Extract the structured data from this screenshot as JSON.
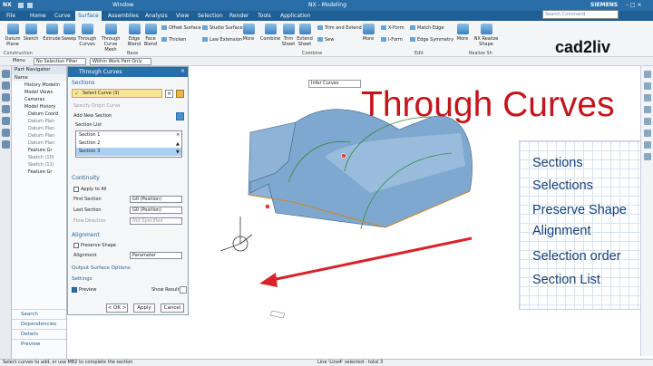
{
  "titlebar": {
    "logo": "NX",
    "window_menu": "Window",
    "title": "NX - Modeling",
    "brand": "SIEMENS"
  },
  "menu": [
    "File",
    "Home",
    "Curve",
    "Surface",
    "Assemblies",
    "Analysis",
    "View",
    "Selection",
    "Render",
    "Tools",
    "Application"
  ],
  "menu_active": "Surface",
  "search": {
    "placeholder": "Search Command"
  },
  "ribbon": {
    "buttons": [
      "Datum Plane",
      "Sketch",
      "Extrude",
      "Sweep",
      "Through Curves",
      "Through Curve Mesh",
      "Edge Blend",
      "Face Blend",
      "More",
      "Combine",
      "Trim Sheet",
      "Extend Sheet",
      "More",
      "X-Form",
      "I-Form",
      "More",
      "NX Realize Shape"
    ],
    "small": [
      "Offset Surface",
      "Studio Surface",
      "Thicken",
      "Law Extension",
      "Trim and Extend",
      "Sew",
      "Match Edge",
      "Edge Symmetry"
    ],
    "groups": [
      "Construction",
      "Base",
      "Combine",
      "Edit",
      "Realize Sh"
    ]
  },
  "toolbar": {
    "menu": "Menu",
    "filter": "No Selection Filter",
    "scope": "Within Work Part Only"
  },
  "brand_text": "cad2liv",
  "partnav": {
    "title": "Part Navigator",
    "col": "Name",
    "items": [
      "History Modelin",
      "Model Views",
      "Cameras",
      "Model History",
      "Datum Coord",
      "Datum Plan",
      "Datum Plan",
      "Datum Plan",
      "Datum Plan",
      "Feature Gr",
      "Sketch (10)",
      "Sketch (11)",
      "Feature Gr"
    ],
    "panels": [
      "Search",
      "Dependencies",
      "Details",
      "Preview"
    ]
  },
  "dialog": {
    "title": "Through Curves",
    "sections": "Sections",
    "select_curve": "Select Curve (3)",
    "specify_origin": "Specify Origin Curve",
    "add_new": "Add New Section",
    "section_list": "Section List",
    "list": [
      "Section 1",
      "Section 2",
      "Section 3"
    ],
    "continuity": "Continuity",
    "apply_to_all": "Apply to All",
    "first_section": "First Section",
    "first_val": "G0 (Position)",
    "last_section": "Last Section",
    "last_val": "G0 (Position)",
    "flow": "Flow Direction",
    "flow_val": "Not Specified",
    "alignment": "Alignment",
    "preserve": "Preserve Shape",
    "align_label": "Alignment",
    "align_val": "Parameter",
    "output": "Output Surface Options",
    "settings": "Settings",
    "preview": "Preview",
    "show_result": "Show Result",
    "ok": "< OK >",
    "apply": "Apply",
    "cancel": "Cancel"
  },
  "viewport": {
    "infer": "Infer Curves",
    "title": "Through Curves"
  },
  "right_panel": [
    "Sections",
    "Selections",
    "Preserve Shape",
    "Alignment",
    "Selection order",
    "Section List"
  ],
  "status": {
    "left": "Select curves to add, or use MB2 to complete the section",
    "right": "Line 'Line4' selected - total 3"
  },
  "colors": {
    "title_red": "#c3161c",
    "nx_blue": "#2a6ea8",
    "arrow": "#d8232a",
    "surface": "#7ea8cf"
  }
}
